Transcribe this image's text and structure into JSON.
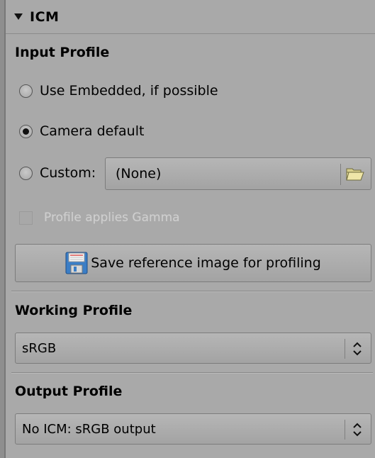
{
  "section": {
    "title": "ICM"
  },
  "input_profile": {
    "heading": "Input Profile",
    "options": [
      {
        "label": "Use Embedded, if possible",
        "checked": false
      },
      {
        "label": "Camera default",
        "checked": true
      },
      {
        "label": "Custom:",
        "checked": false
      }
    ],
    "custom_value": "(None)",
    "gamma_checkbox_label": "Profile applies Gamma",
    "gamma_checked": false,
    "save_button_label": "Save reference image for profiling"
  },
  "working_profile": {
    "heading": "Working Profile",
    "selected": "sRGB"
  },
  "output_profile": {
    "heading": "Output Profile",
    "selected": "No ICM: sRGB output"
  },
  "icons": {
    "collapse": "triangle-down-icon",
    "folder": "folder-open-icon",
    "save": "floppy-disk-icon",
    "spinner": "up-down-arrows-icon"
  }
}
